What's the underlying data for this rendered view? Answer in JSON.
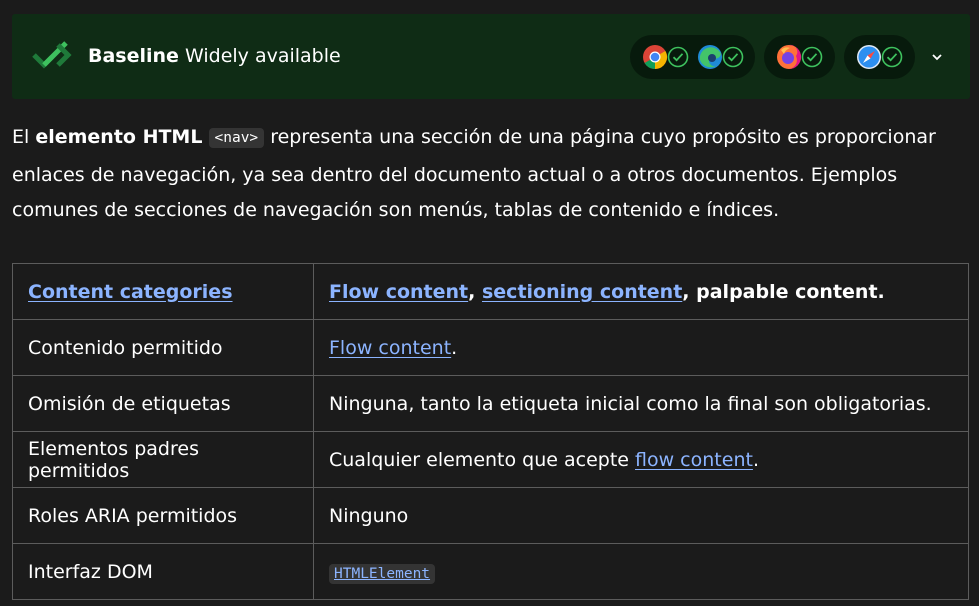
{
  "baseline": {
    "label": "Baseline",
    "status": "Widely available",
    "browsers": [
      {
        "name": "Chrome",
        "icon": "chrome-icon",
        "supported": true
      },
      {
        "name": "Edge",
        "icon": "edge-icon",
        "supported": true
      },
      {
        "name": "Firefox",
        "icon": "firefox-icon",
        "supported": true
      },
      {
        "name": "Safari",
        "icon": "safari-icon",
        "supported": true
      }
    ],
    "colors": {
      "banner_bg": "#0f2c15",
      "pill_bg": "#071a0c",
      "check": "#3ec15e"
    }
  },
  "intro": {
    "p1": "El ",
    "strong": "elemento HTML",
    "code": "<nav>",
    "rest": " representa una sección de una página cuyo propósito es proporcionar enlaces de navegación, ya sea dentro del documento actual o a otros documentos. Ejemplos comunes de secciones de navegación son menús, tablas de contenido e índices."
  },
  "table": {
    "row1": {
      "label": "Content categories",
      "link1": "Flow content",
      "sep1": ", ",
      "link2": "sectioning content",
      "tail": ", palpable content."
    },
    "row2": {
      "label": "Contenido permitido",
      "link": "Flow content",
      "tail": "."
    },
    "row3": {
      "label": "Omisión de etiquetas",
      "value": "Ninguna, tanto la etiqueta inicial como la final son obligatorias."
    },
    "row4": {
      "label": "Elementos padres permitidos",
      "pre": "Cualquier elemento que acepte ",
      "link": "flow content",
      "tail": "."
    },
    "row5": {
      "label": "Roles ARIA permitidos",
      "value": "Ninguno"
    },
    "row6": {
      "label": "Interfaz DOM",
      "code": "HTMLElement"
    }
  },
  "colors": {
    "background": "#1b1b1b",
    "link": "#8cb4ff",
    "border": "#5c5c5c"
  }
}
